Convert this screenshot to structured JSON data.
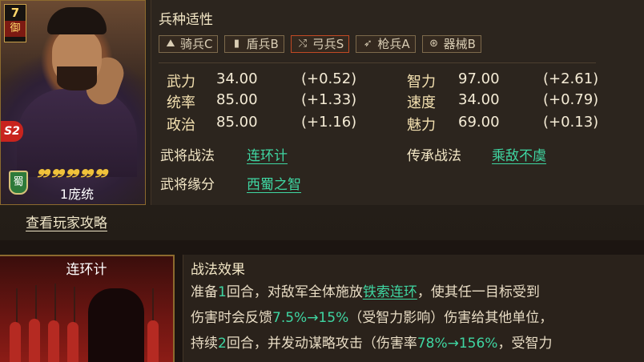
{
  "hero": {
    "rank_number": "7",
    "rank_kind": "御",
    "skill_badge": "S2",
    "faction": "蜀",
    "stars": [
      "❠",
      "❠",
      "❠",
      "❠",
      "❠"
    ],
    "name": "1庞统",
    "guide_link": "查看玩家攻略"
  },
  "troop_affinity": {
    "title": "兵种适性",
    "items": [
      {
        "icon": "cavalry-icon",
        "glyph": "⛰",
        "label": "骑兵C"
      },
      {
        "icon": "shield-icon",
        "glyph": "▮",
        "label": "盾兵B"
      },
      {
        "icon": "bow-icon",
        "glyph": "⤭",
        "label": "弓兵S"
      },
      {
        "icon": "spear-icon",
        "glyph": "➶",
        "label": "枪兵A"
      },
      {
        "icon": "siege-icon",
        "glyph": "⊛",
        "label": "器械B"
      }
    ]
  },
  "stats": {
    "left": [
      {
        "label": "武力",
        "value": "34.00",
        "bonus": "(+0.52)"
      },
      {
        "label": "统率",
        "value": "85.00",
        "bonus": "(+1.33)"
      },
      {
        "label": "政治",
        "value": "85.00",
        "bonus": "(+1.16)"
      }
    ],
    "right": [
      {
        "label": "智力",
        "value": "97.00",
        "bonus": "(+2.61)"
      },
      {
        "label": "速度",
        "value": "34.00",
        "bonus": "(+0.79)"
      },
      {
        "label": "魅力",
        "value": "69.00",
        "bonus": "(+0.13)"
      }
    ]
  },
  "skills": {
    "hero_tactic_label": "武将战法",
    "hero_tactic_value": "连环计",
    "inherit_tactic_label": "传承战法",
    "inherit_tactic_value": "乘敌不虞",
    "bond_label": "武将缘分",
    "bond_value": "西蜀之智"
  },
  "tactic_card": {
    "title": "连环计"
  },
  "tactic_effect": {
    "title": "战法效果",
    "line1_a": "准备",
    "line1_b": "1",
    "line1_c": "回合，对敌军全体施放",
    "line1_link": "铁索连环",
    "line1_d": "，使其任一目标受到",
    "line2_a": "伤害时会反馈",
    "line2_b": "7.5%→15%",
    "line2_c": "（受智力影响）伤害给其他单位，",
    "line3_a": "持续",
    "line3_b": "2",
    "line3_c": "回合，并发动谋略攻击（伤害率",
    "line3_d": "78%→156%",
    "line3_e": "，受智力"
  },
  "colors": {
    "accent_green": "#3fd6a2",
    "gold_border": "#8c6a2e",
    "highlight_border": "#c24a24"
  }
}
